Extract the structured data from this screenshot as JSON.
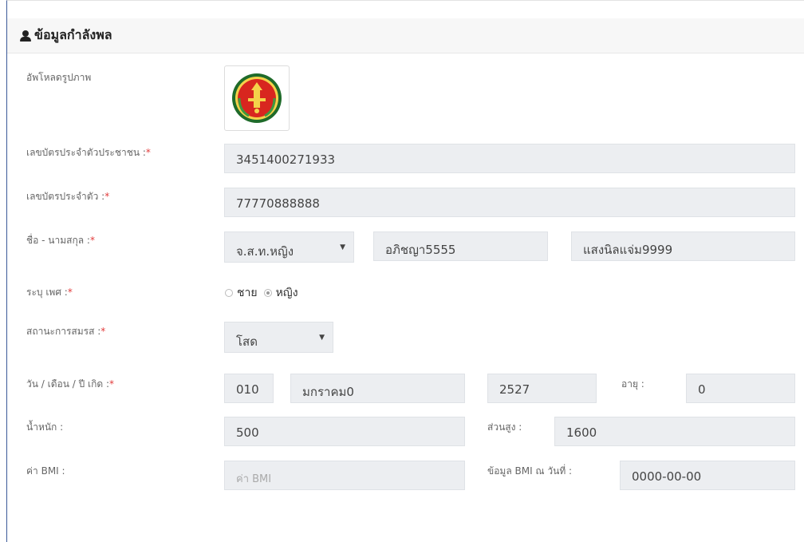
{
  "panel": {
    "title": "ข้อมูลกำลังพล"
  },
  "form": {
    "photo_label": "อัพโหลดรูปภาพ",
    "id_card_label": "เลขบัตรประจำตัวประชาชน :",
    "id_card_value": "3451400271933",
    "staff_id_label": "เลขบัตรประจำตัว :",
    "staff_id_value": "77770888888",
    "name_label": "ชื่อ - นามสกุล :",
    "rank_value": "จ.ส.ท.หญิง",
    "first_name_value": "อภิชญา5555",
    "last_name_value": "แสงนิลแจ่ม9999",
    "gender_label": "ระบุ เพศ :",
    "gender_options": [
      "ชาย",
      "หญิง"
    ],
    "gender_selected": "หญิง",
    "marital_label": "สถานะการสมรส :",
    "marital_value": "โสด",
    "dob_label": "วัน / เดือน / ปี เกิด :",
    "dob_day": "010",
    "dob_month": "มกราคม0",
    "dob_year": "2527",
    "age_label": "อายุ :",
    "age_value": "0",
    "weight_label": "น้ำหนัก :",
    "weight_value": "500",
    "height_label": "ส่วนสูง :",
    "height_value": "1600",
    "bmi_label": "ค่า BMI :",
    "bmi_placeholder": "ค่า BMI",
    "bmi_date_label": "ข้อมูล BMI ณ วันที่ :",
    "bmi_date_value": "0000-00-00",
    "required_mark": "*",
    "caret": "▼"
  },
  "colors": {
    "required": "#e23b3b",
    "field_bg": "#eceef1",
    "frame_border": "#3b5998"
  }
}
